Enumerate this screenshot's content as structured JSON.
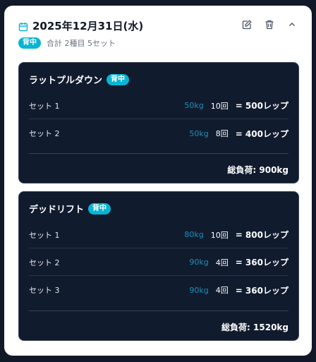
{
  "header": {
    "date": "2025年12月31日(水)",
    "badge": "背中",
    "summary": "合計 2種目 5セット"
  },
  "icons": [
    "calendar-icon",
    "edit-icon",
    "trash-icon",
    "chevron-up-icon"
  ],
  "colors": {
    "accent": "#06b6d4",
    "weight": "#1f8fb8",
    "panel": "#111b2e"
  },
  "exercises": [
    {
      "name": "ラットプルダウン",
      "badge": "背中",
      "sets": [
        {
          "label": "セット 1",
          "weight": "50kg",
          "reps": "10回",
          "result": "= 500レップ"
        },
        {
          "label": "セット 2",
          "weight": "50kg",
          "reps": "8回",
          "result": "= 400レップ"
        }
      ],
      "total": "総負荷: 900kg"
    },
    {
      "name": "デッドリフト",
      "badge": "背中",
      "sets": [
        {
          "label": "セット 1",
          "weight": "80kg",
          "reps": "10回",
          "result": "= 800レップ"
        },
        {
          "label": "セット 2",
          "weight": "90kg",
          "reps": "4回",
          "result": "= 360レップ"
        },
        {
          "label": "セット 3",
          "weight": "90kg",
          "reps": "4回",
          "result": "= 360レップ"
        }
      ],
      "total": "総負荷: 1520kg"
    }
  ]
}
